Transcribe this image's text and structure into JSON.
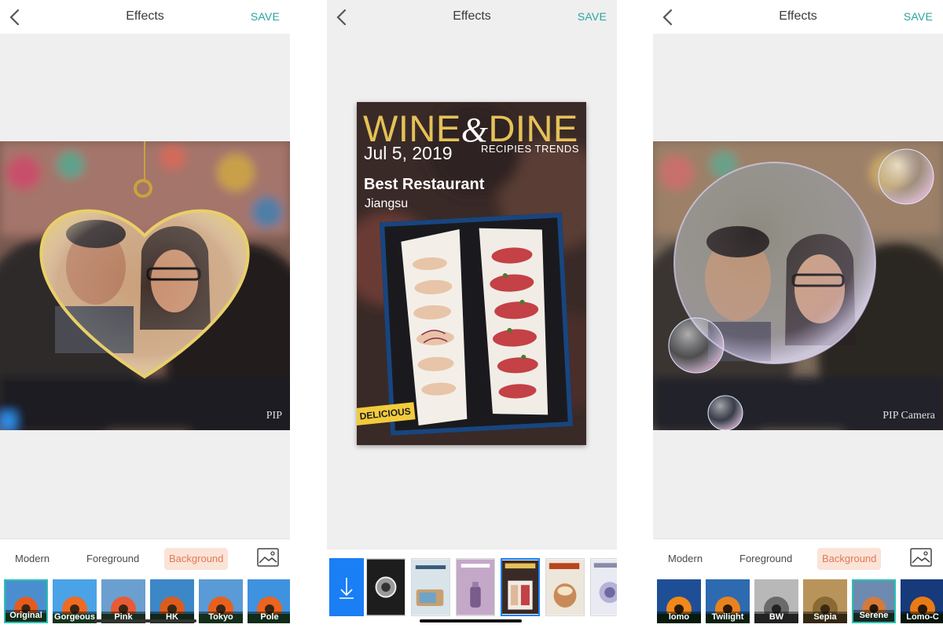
{
  "screens": [
    {
      "nav": {
        "title": "Effects",
        "save_label": "SAVE"
      },
      "frame": "heart-locket",
      "watermark": "PIP",
      "tabs": [
        {
          "label": "Modern",
          "active": false
        },
        {
          "label": "Foreground",
          "active": false
        },
        {
          "label": "Background",
          "active": true
        }
      ],
      "filters": [
        {
          "label": "Original",
          "selected": true
        },
        {
          "label": "Gorgeous",
          "selected": false
        },
        {
          "label": "Pink",
          "selected": false
        },
        {
          "label": "HK",
          "selected": false
        },
        {
          "label": "Tokyo",
          "selected": false
        },
        {
          "label": "Pole",
          "selected": false
        }
      ]
    },
    {
      "nav": {
        "title": "Effects",
        "save_label": "SAVE"
      },
      "magazine": {
        "title_left": "WINE",
        "title_amp": "&",
        "title_right": "DINE",
        "date": "Jul 5, 2019",
        "tagline": "RECIPIES TRENDS",
        "headline": "Best Restaurant",
        "subhead": "Jiangsu",
        "badge": "DELICIOUS"
      },
      "templates": [
        {
          "icon": "camera-lens-icon",
          "selected": false
        },
        {
          "icon": "camera-photo-icon",
          "selected": false
        },
        {
          "icon": "sunshine-bottle-icon",
          "selected": false
        },
        {
          "icon": "wine-dine-icon",
          "selected": true
        },
        {
          "icon": "delicious-icon",
          "selected": false
        },
        {
          "icon": "frozen-icon",
          "selected": false
        }
      ],
      "download_icon": "download-arrow-icon"
    },
    {
      "nav": {
        "title": "Effects",
        "save_label": "SAVE"
      },
      "frame": "bubble",
      "watermark": "PIP Camera",
      "tabs": [
        {
          "label": "Modern",
          "active": false
        },
        {
          "label": "Foreground",
          "active": false
        },
        {
          "label": "Background",
          "active": true
        }
      ],
      "filters": [
        {
          "label": "lomo",
          "selected": false
        },
        {
          "label": "Twilight",
          "selected": false
        },
        {
          "label": "BW",
          "selected": false
        },
        {
          "label": "Sepia",
          "selected": false
        },
        {
          "label": "Serene",
          "selected": true
        },
        {
          "label": "Lomo-C",
          "selected": false
        }
      ]
    }
  ],
  "colors": {
    "accent": "#2aa59b",
    "active_tab_bg": "#fbe3d8",
    "active_tab_text": "#e07a55",
    "selected_filter_border": "#27c2b1",
    "download_button": "#1a7ef5",
    "magazine_gold": "#e5c158"
  }
}
